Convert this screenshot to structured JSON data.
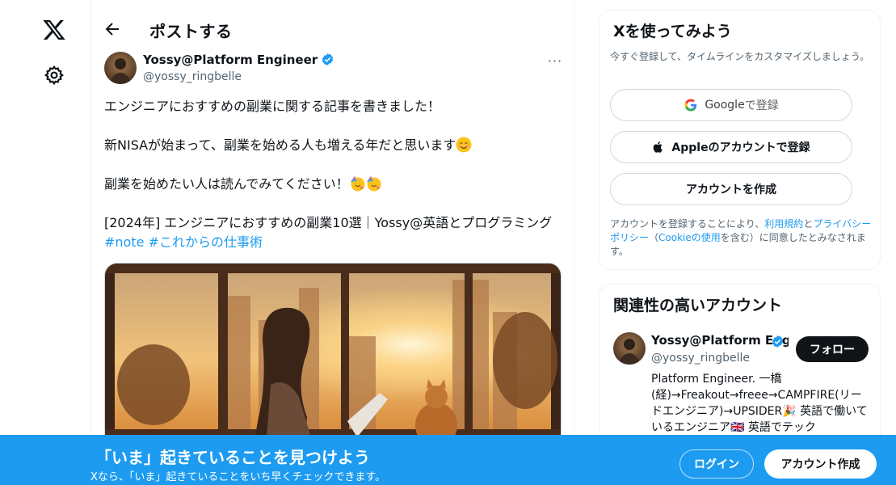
{
  "nav": {
    "logo_icon": "x-logo-icon",
    "settings_icon": "gear-icon"
  },
  "header": {
    "title": "ポストする",
    "back_icon": "arrow-left-icon"
  },
  "tweet": {
    "author_name": "Yossy@Platform Engineer",
    "author_handle": "@yossy_ringbelle",
    "verified_color": "#1d9bf0",
    "more_label": "···",
    "line1": "エンジニアにおすすめの副業に関する記事を書きました！",
    "line2": "新NISAが始まって、副業を始める人も増える年だと思います",
    "line2_emoji": "smiling-face-icon",
    "line3": "副業を始めたい人は読んでみてください！",
    "line3_emoji": "partying-face-icon",
    "line4": "[2024年] エンジニアにおすすめの副業10選｜Yossy@英語とプログラミング",
    "hashtags": [
      "#note",
      "#これからの仕事術"
    ]
  },
  "signup": {
    "title": "Xを使ってみよう",
    "subtitle": "今すぐ登録して、タイムラインをカスタマイズしましょう。",
    "google_brand": "Google",
    "google_suffix": " で登録",
    "apple_label": "Appleのアカウントで登録",
    "create_label": "アカウントを作成",
    "terms_prefix": "アカウントを登録することにより、",
    "terms_link1": "利用規約",
    "terms_link2": "プライバシーポリシー",
    "terms_mid1": "と",
    "terms_mid2": "（",
    "terms_link3": "Cookieの使用",
    "terms_suffix": "を含む）に同意したとみなされます。"
  },
  "related": {
    "title": "関連性の高いアカウント",
    "name": "Yossy@Platform Engineer",
    "handle": "@yossy_ringbelle",
    "follow_label": "フォロー",
    "bio": "Platform Engineer. 一橋(経)→Freakout→freee→CAMPFIRE(リードエンジニア)→UPSIDER🎉 英語で働いているエンジニア🇬🇧 英語でテック"
  },
  "banner": {
    "title": "「いま」起きていることを見つけよう",
    "subtitle": "Xなら、「いま」起きていることをいち早くチェックできます。",
    "login_label": "ログイン",
    "signup_label": "アカウント作成",
    "background_color": "#1d9bf0"
  }
}
